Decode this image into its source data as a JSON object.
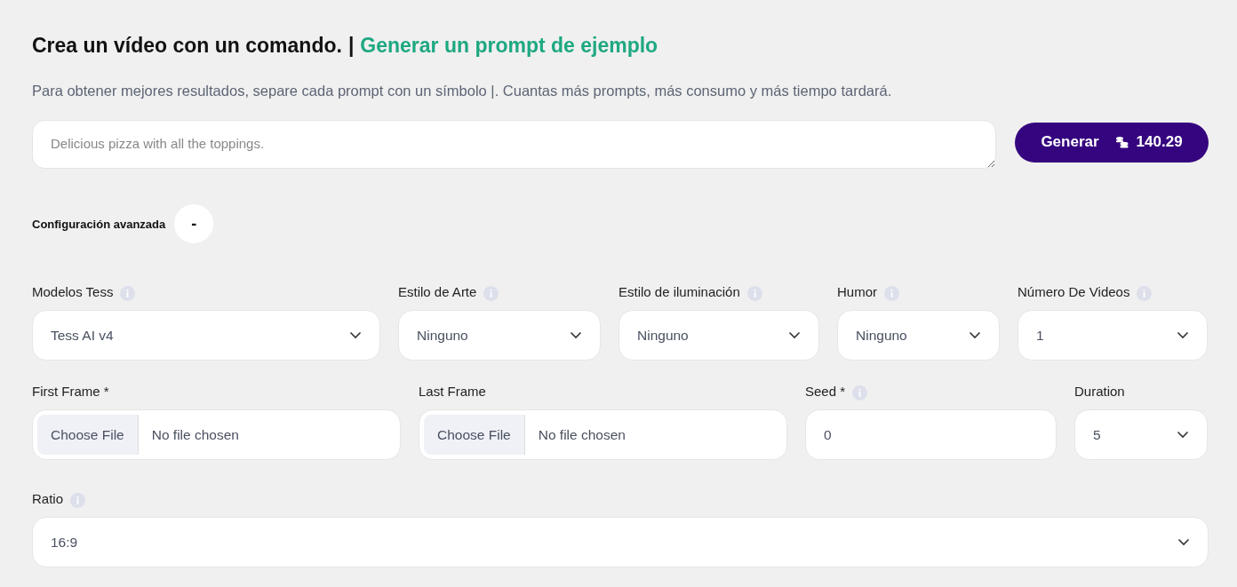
{
  "header": {
    "title": "Crea un vídeo con un comando.",
    "separator": "|",
    "example_link": "Generar un prompt de ejemplo",
    "hint": "Para obtener mejores resultados, separe cada prompt con un símbolo |. Cuantas más prompts, más consumo y más tiempo tardará."
  },
  "prompt": {
    "placeholder": "Delicious pizza with all the toppings.",
    "button": "Generar",
    "credits": "140.29"
  },
  "advanced": {
    "label": "Configuración avanzada",
    "toggle": "-"
  },
  "rows": [
    [
      {
        "kind": "select",
        "label": "Modelos Tess",
        "info": true,
        "value": "Tess AI v4"
      },
      {
        "kind": "select",
        "label": "Estilo de Arte",
        "info": true,
        "value": "Ninguno"
      },
      {
        "kind": "select",
        "label": "Estilo de iluminación",
        "info": true,
        "value": "Ninguno"
      },
      {
        "kind": "select",
        "label": "Humor",
        "info": true,
        "value": "Ninguno"
      },
      {
        "kind": "select",
        "label": "Número De Videos",
        "info": true,
        "value": "1"
      }
    ],
    [
      {
        "kind": "file",
        "label": "First Frame *",
        "info": false,
        "button": "Choose File",
        "value": "No file chosen"
      },
      {
        "kind": "file",
        "label": "Last Frame",
        "info": false,
        "button": "Choose File",
        "value": "No file chosen"
      },
      {
        "kind": "number",
        "label": "Seed *",
        "info": true,
        "value": "0"
      },
      {
        "kind": "select",
        "label": "Duration",
        "info": false,
        "value": "5"
      }
    ],
    [
      {
        "kind": "select",
        "label": "Ratio",
        "info": true,
        "value": "16:9"
      }
    ]
  ]
}
